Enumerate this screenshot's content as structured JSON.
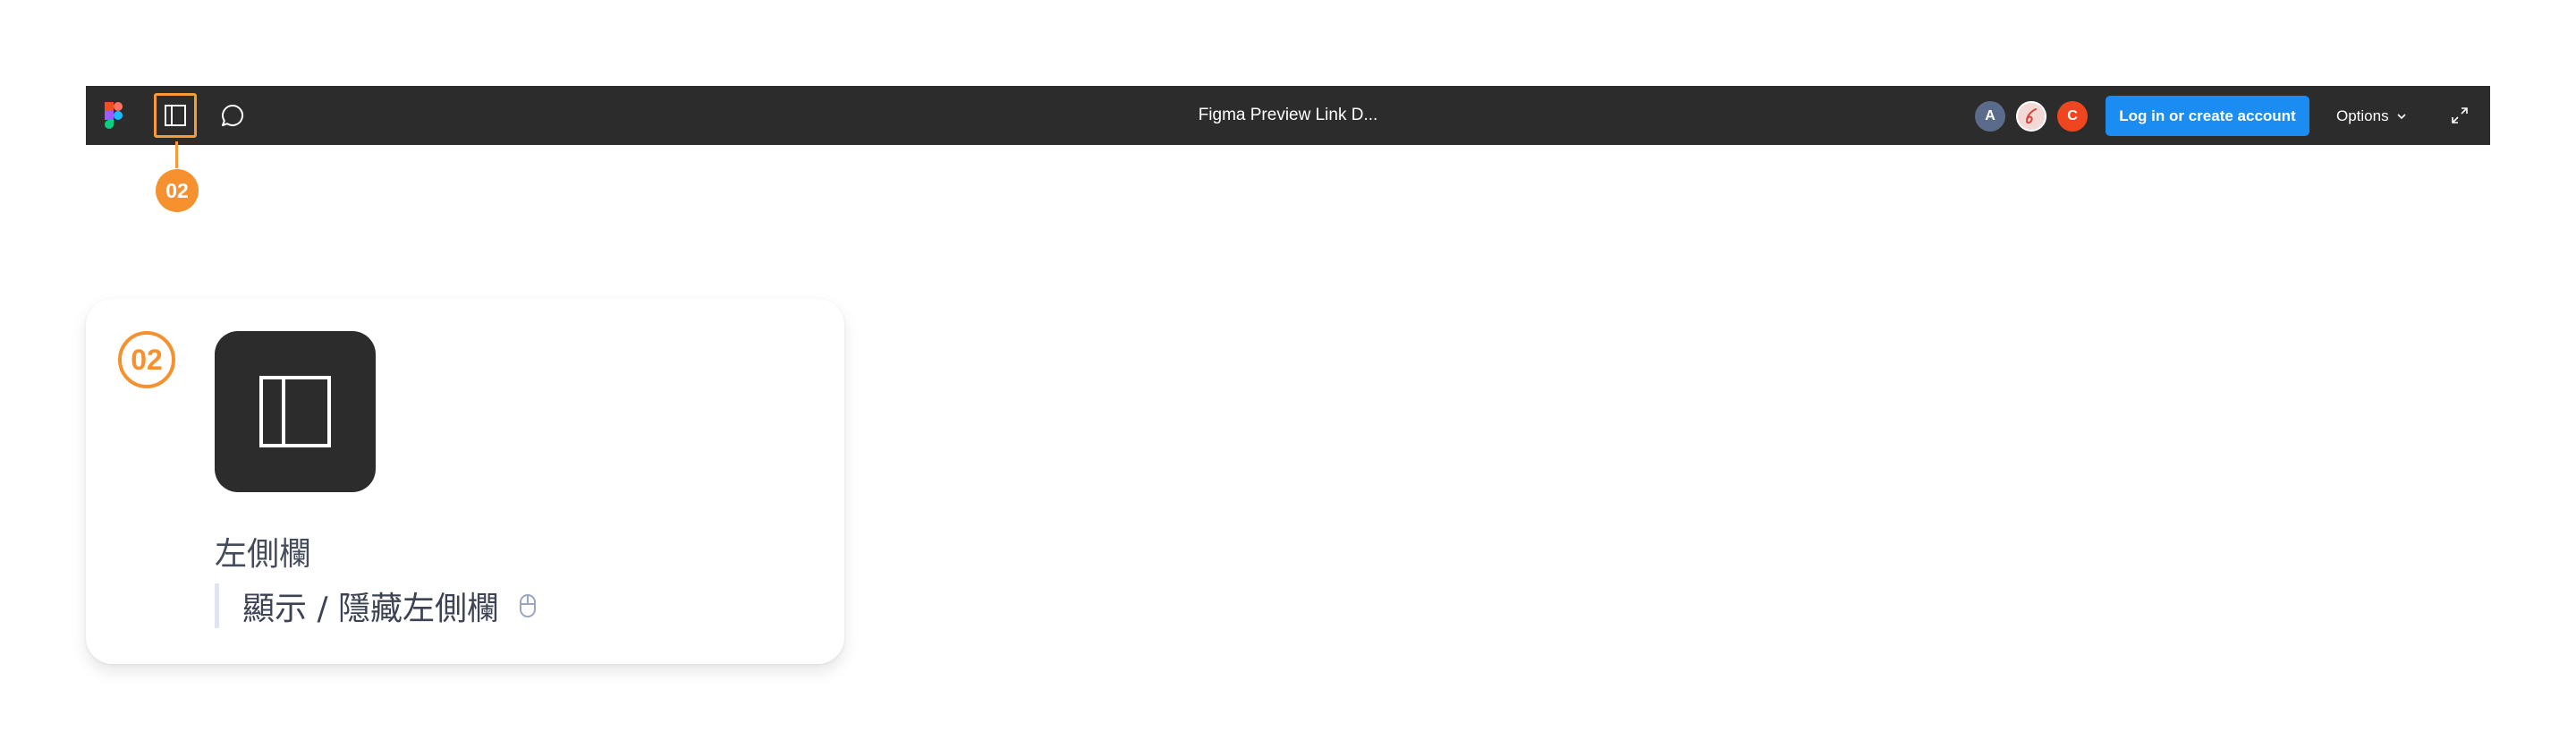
{
  "toolbar": {
    "title": "Figma Preview Link D...",
    "login_label": "Log in or create account",
    "options_label": "Options",
    "avatars": [
      {
        "letter": "A",
        "color": "#5a6b8c"
      },
      {
        "letter": "",
        "icon": "avatar-image",
        "color": "#f3d9d6"
      },
      {
        "letter": "C",
        "color": "#f0461f"
      }
    ],
    "icons": [
      "figma-logo-icon",
      "sidebar-panel-icon",
      "comment-icon",
      "chevron-down-icon",
      "expand-icon"
    ]
  },
  "callout": {
    "badge": "02",
    "color": "#f5922f"
  },
  "card": {
    "number": "02",
    "title": "左側欄",
    "description": "顯示 / 隱藏左側欄",
    "icons": [
      "sidebar-panel-icon",
      "mouse-icon"
    ]
  },
  "colors": {
    "toolbar_bg": "#2c2c2c",
    "accent": "#f5922f",
    "primary_button": "#1b8cf2"
  }
}
